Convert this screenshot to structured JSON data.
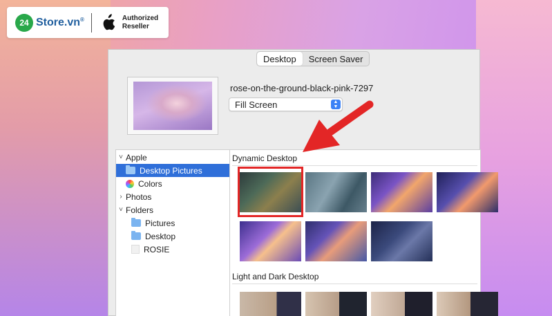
{
  "logo": {
    "badge_number": "24",
    "brand": "Store.vn",
    "registered": "®",
    "auth_line1": "Authorized",
    "auth_line2": "Reseller"
  },
  "tabs": [
    {
      "label": "Desktop",
      "active": true
    },
    {
      "label": "Screen Saver",
      "active": false
    }
  ],
  "wallpaper": {
    "name": "rose-on-the-ground-black-pink-7297",
    "fit_option": "Fill Screen"
  },
  "sidebar": {
    "items": [
      {
        "label": "Apple",
        "chevron": "˅",
        "icon": "none"
      },
      {
        "label": "Desktop Pictures",
        "icon": "folder-icon",
        "selected": true
      },
      {
        "label": "Colors",
        "icon": "colors-icon"
      },
      {
        "label": "Photos",
        "chevron": "›",
        "icon": "none"
      },
      {
        "label": "Folders",
        "chevron": "˅",
        "icon": "none"
      },
      {
        "label": "Pictures",
        "icon": "folder-icon"
      },
      {
        "label": "Desktop",
        "icon": "folder-icon"
      },
      {
        "label": "ROSIE",
        "icon": "blank-icon"
      }
    ]
  },
  "content": {
    "sections": [
      {
        "title": "Dynamic Desktop"
      },
      {
        "title": "Light and Dark Desktop"
      }
    ]
  },
  "colors": {
    "highlight": "#e32626",
    "arrow": "#e32626",
    "selection": "#2f6fd9"
  }
}
